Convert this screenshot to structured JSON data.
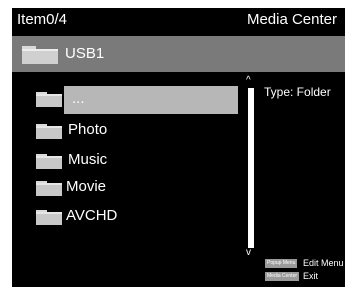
{
  "header": {
    "item_counter": "Item0/4",
    "app_title": "Media Center"
  },
  "path_bar": {
    "current": "USB1"
  },
  "file_list": {
    "items": [
      {
        "label": "...",
        "selected": true
      },
      {
        "label": "Photo",
        "selected": false
      },
      {
        "label": "Music",
        "selected": false
      },
      {
        "label": "Movie",
        "selected": false
      },
      {
        "label": "AVCHD",
        "selected": false
      }
    ]
  },
  "info": {
    "type": "Type: Folder"
  },
  "scroll": {
    "up_glyph": "^",
    "down_glyph": "v"
  },
  "menu": {
    "popup_key": "Popup Menu",
    "popup_label": "Edit Menu",
    "exit_key": "Media Center",
    "exit_label": "Exit"
  },
  "colors": {
    "background": "#000000",
    "path_bar": "#7a7a7a",
    "selection": "#b7b7b7",
    "folder": "#c8c8c8",
    "text": "#ffffff"
  },
  "icons": {
    "folder": "folder-icon",
    "scroll_up": "scroll-up-icon",
    "scroll_down": "scroll-down-icon"
  }
}
